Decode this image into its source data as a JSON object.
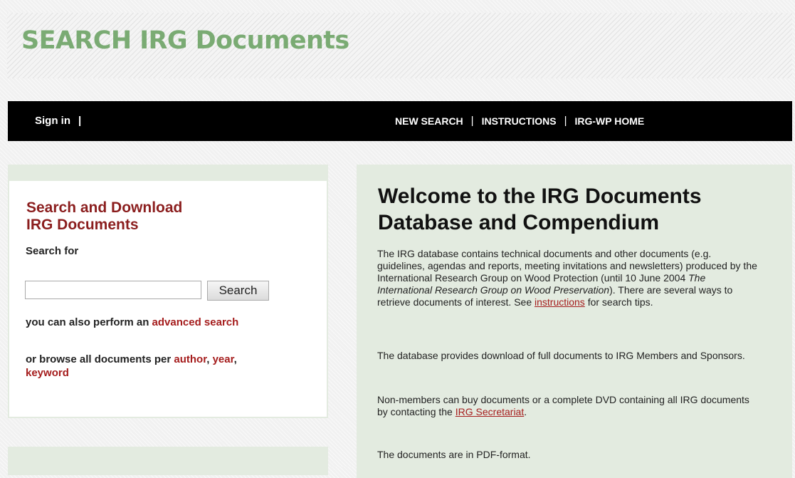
{
  "header": {
    "title": "SEARCH IRG Documents"
  },
  "navbar": {
    "signin_label": "Sign in",
    "signin_separator": "|",
    "links": [
      {
        "label": "NEW SEARCH"
      },
      {
        "label": "INSTRUCTIONS"
      },
      {
        "label": "IRG-WP HOME"
      }
    ],
    "link_separator": "|"
  },
  "search_box": {
    "heading_line1": "Search and Download",
    "heading_line2": "IRG Documents",
    "search_for_label": "Search for",
    "input_value": "",
    "button_label": "Search",
    "advanced_prefix": "you can also perform an ",
    "advanced_link": "advanced search",
    "browse_prefix": "or browse all documents per ",
    "browse_author": "author",
    "browse_comma1": ", ",
    "browse_year": "year",
    "browse_comma2": ",",
    "browse_keyword": "keyword"
  },
  "welcome": {
    "title": "Welcome to the IRG Documents Database and Compendium",
    "para1_part1": "The IRG database contains technical documents and other documents (e.g. guidelines, agendas and reports, meeting invitations and newsletters) produced by the International Research Group on Wood Protection (until 10 June 2004 ",
    "para1_italic": "The International Research Group on Wood Preservation",
    "para1_part2": "). There are several ways to retrieve documents of interest. See ",
    "para1_link": "instructions",
    "para1_part3": " for search tips.",
    "para2": "The database provides download of full documents to IRG Members and Sponsors.",
    "para3_part1": "Non-members can buy documents or a complete DVD containing all IRG documents by contacting the ",
    "para3_link": "IRG Secretariat",
    "para3_part2": ".",
    "para4": "The documents are in PDF-format."
  },
  "colors": {
    "title_green": "#7aab73",
    "heading_red": "#8b1e1e",
    "link_red": "#a51d1d",
    "panel_green": "#e3ebe0",
    "navbar_black": "#000000"
  }
}
